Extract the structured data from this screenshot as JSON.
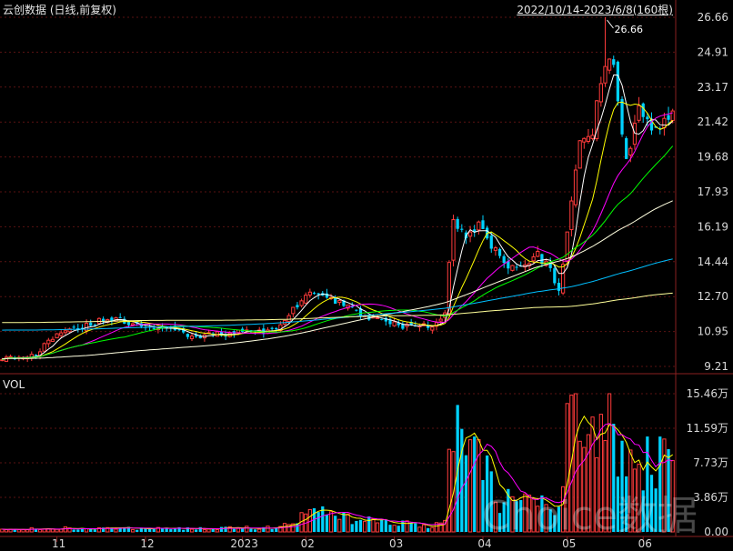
{
  "header": {
    "title": "云创数据 (日线,前复权)",
    "range": "2022/10/14-2023/6/8(160根)",
    "vol_label": "VOL"
  },
  "colors": {
    "background": "#000000",
    "grid": "#5a1212",
    "up": "#ff3b3b",
    "down": "#00d2ff",
    "ma5": "#ffffff",
    "ma10": "#ffff00",
    "ma20": "#ff00ff",
    "ma30": "#00ff00",
    "ma60": "#ffffe0",
    "ma120": "#00bfff",
    "ma250": "#ffff99",
    "axis_text": "#d8d8d8"
  },
  "chart_data": [
    {
      "type": "candlestick",
      "ylim": [
        9.21,
        26.66
      ],
      "y_ticks": [
        "26.66",
        "24.91",
        "23.17",
        "21.42",
        "19.68",
        "17.93",
        "16.19",
        "14.44",
        "12.70",
        "10.95",
        "9.21"
      ],
      "x_ticks": [
        "11",
        "12",
        "2023",
        "02",
        "03",
        "04",
        "05",
        "06"
      ],
      "annotation": "26.66",
      "max_point": {
        "value": 26.66,
        "month_index": 7
      },
      "month_starts": [
        13,
        34,
        57,
        72,
        93,
        114,
        134,
        152
      ],
      "close_keypoints": [
        [
          0,
          9.5
        ],
        [
          8,
          9.8
        ],
        [
          13,
          10.9
        ],
        [
          20,
          11.3
        ],
        [
          26,
          11.6
        ],
        [
          34,
          11.2
        ],
        [
          40,
          11.0
        ],
        [
          46,
          10.7
        ],
        [
          52,
          10.8
        ],
        [
          57,
          10.9
        ],
        [
          63,
          10.9
        ],
        [
          67,
          11.4
        ],
        [
          70,
          12.3
        ],
        [
          73,
          13.0
        ],
        [
          77,
          12.6
        ],
        [
          82,
          12.2
        ],
        [
          87,
          11.6
        ],
        [
          92,
          11.3
        ],
        [
          97,
          11.2
        ],
        [
          102,
          11.2
        ],
        [
          105,
          12.0
        ],
        [
          107,
          16.5
        ],
        [
          110,
          15.8
        ],
        [
          113,
          16.2
        ],
        [
          116,
          15.2
        ],
        [
          120,
          14.1
        ],
        [
          124,
          14.4
        ],
        [
          127,
          14.8
        ],
        [
          130,
          14.0
        ],
        [
          132,
          12.9
        ],
        [
          134,
          16.0
        ],
        [
          137,
          20.5
        ],
        [
          140,
          21.0
        ],
        [
          143,
          25.0
        ],
        [
          145,
          24.0
        ],
        [
          148,
          19.5
        ],
        [
          151,
          22.0
        ],
        [
          154,
          21.0
        ],
        [
          157,
          21.4
        ],
        [
          159,
          22.2
        ]
      ],
      "moving_averages": [
        {
          "period": 5,
          "last": 21.6
        },
        {
          "period": 10,
          "last": 21.4
        },
        {
          "period": 20,
          "last": 21.1
        },
        {
          "period": 30,
          "last": 19.9
        },
        {
          "period": 60,
          "last": 16.9
        },
        {
          "period": 120,
          "last": 14.2
        },
        {
          "period": 250,
          "last": 12.4
        }
      ]
    },
    {
      "type": "bar",
      "name": "VOL",
      "ylim": [
        0,
        15.46
      ],
      "y_ticks": [
        "15.46万",
        "11.59万",
        "7.73万",
        "3.86万",
        "0.00"
      ],
      "unit": "万",
      "volume_keypoints": [
        [
          0,
          0.35
        ],
        [
          20,
          0.45
        ],
        [
          45,
          0.35
        ],
        [
          66,
          0.5
        ],
        [
          70,
          1.6
        ],
        [
          75,
          2.6
        ],
        [
          80,
          1.8
        ],
        [
          90,
          1.1
        ],
        [
          100,
          0.7
        ],
        [
          105,
          0.9
        ],
        [
          106,
          8.0
        ],
        [
          108,
          14.5
        ],
        [
          110,
          6.5
        ],
        [
          113,
          8.5
        ],
        [
          117,
          4.0
        ],
        [
          122,
          3.0
        ],
        [
          127,
          3.5
        ],
        [
          131,
          2.2
        ],
        [
          133,
          5.0
        ],
        [
          135,
          15.4
        ],
        [
          138,
          9.0
        ],
        [
          142,
          10.0
        ],
        [
          144,
          12.5
        ],
        [
          148,
          9.0
        ],
        [
          152,
          8.0
        ],
        [
          156,
          7.5
        ],
        [
          159,
          6.5
        ]
      ],
      "vol_ma5_last": 7.3,
      "vol_ma10_last": 5.5
    }
  ],
  "watermark": "Choice数据"
}
